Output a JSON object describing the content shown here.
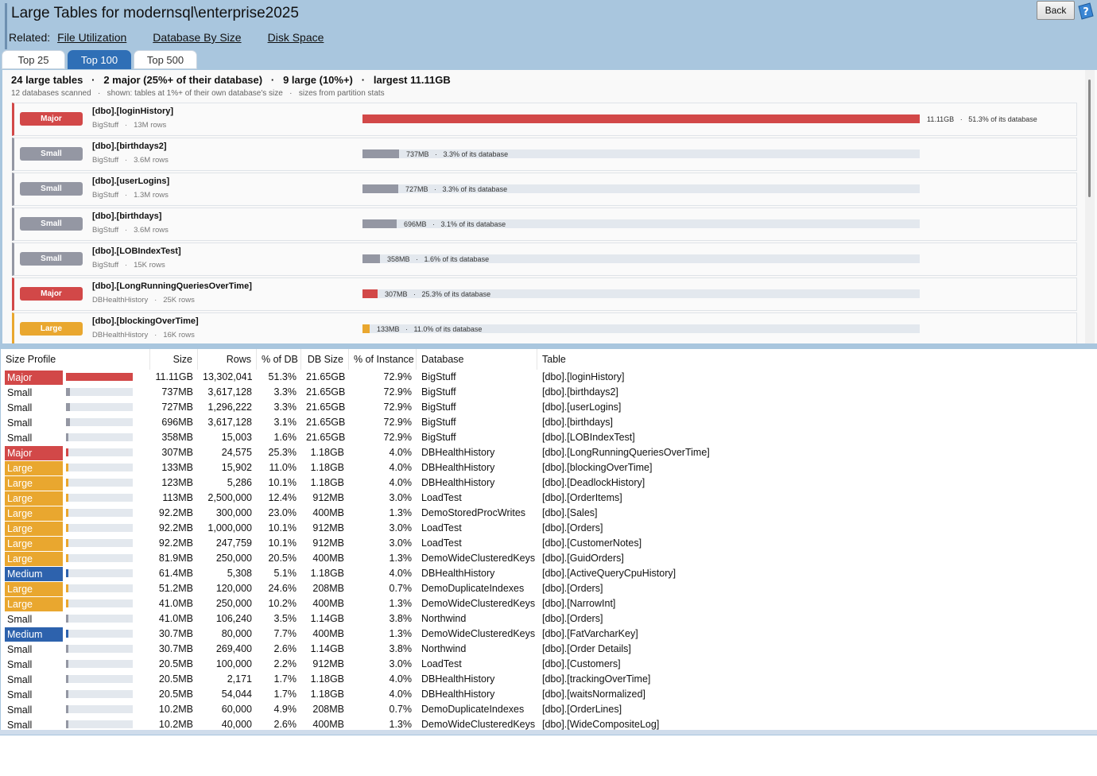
{
  "header": {
    "title": "Large Tables for modernsql\\enterprise2025",
    "back_label": "Back",
    "related_label": "Related:",
    "related_links": [
      "File Utilization",
      "Database By Size",
      "Disk Space"
    ],
    "tabs": [
      {
        "label": "Top 25",
        "active": false
      },
      {
        "label": "Top 100",
        "active": true
      },
      {
        "label": "Top 500",
        "active": false
      }
    ]
  },
  "colors": {
    "Major": "#d24848",
    "Large": "#e9a72f",
    "Medium": "#2d62ad",
    "Small": "#9497a3",
    "accent": "#2f6fb6"
  },
  "summary": {
    "line": "24 large tables   ·   2 major (25%+ of their database)   ·   9 large (10%+)   ·   largest 11.11GB",
    "sub": "12 databases scanned   ·   shown: tables at 1%+ of their own database's size   ·   sizes from partition stats"
  },
  "cards": [
    {
      "profile": "Major",
      "name": "[dbo].[loginHistory]",
      "meta": "BigStuff   ·   13M rows",
      "label": "11.11GB   ·   51.3% of its database",
      "fraction": 1.0
    },
    {
      "profile": "Small",
      "name": "[dbo].[birthdays2]",
      "meta": "BigStuff   ·   3.6M rows",
      "label": "737MB   ·   3.3% of its database",
      "fraction": 0.065
    },
    {
      "profile": "Small",
      "name": "[dbo].[userLogins]",
      "meta": "BigStuff   ·   1.3M rows",
      "label": "727MB   ·   3.3% of its database",
      "fraction": 0.064
    },
    {
      "profile": "Small",
      "name": "[dbo].[birthdays]",
      "meta": "BigStuff   ·   3.6M rows",
      "label": "696MB   ·   3.1% of its database",
      "fraction": 0.061
    },
    {
      "profile": "Small",
      "name": "[dbo].[LOBIndexTest]",
      "meta": "BigStuff   ·   15K rows",
      "label": "358MB   ·   1.6% of its database",
      "fraction": 0.032
    },
    {
      "profile": "Major",
      "name": "[dbo].[LongRunningQueriesOverTime]",
      "meta": "DBHealthHistory   ·   25K rows",
      "label": "307MB   ·   25.3% of its database",
      "fraction": 0.027
    },
    {
      "profile": "Large",
      "name": "[dbo].[blockingOverTime]",
      "meta": "DBHealthHistory   ·   16K rows",
      "label": "133MB   ·   11.0% of its database",
      "fraction": 0.012
    }
  ],
  "grid": {
    "columns": [
      "Size Profile",
      "Size",
      "Rows",
      "% of DB",
      "DB Size",
      "% of Instance",
      "Database",
      "Table"
    ],
    "rows": [
      {
        "profile": "Major",
        "fraction": 1.0,
        "size": "11.11GB",
        "rows": "13,302,041",
        "pct_db": "51.3%",
        "db_size": "21.65GB",
        "pct_inst": "72.9%",
        "database": "BigStuff",
        "table": "[dbo].[loginHistory]"
      },
      {
        "profile": "Small",
        "fraction": 0.065,
        "size": "737MB",
        "rows": "3,617,128",
        "pct_db": "3.3%",
        "db_size": "21.65GB",
        "pct_inst": "72.9%",
        "database": "BigStuff",
        "table": "[dbo].[birthdays2]"
      },
      {
        "profile": "Small",
        "fraction": 0.064,
        "size": "727MB",
        "rows": "1,296,222",
        "pct_db": "3.3%",
        "db_size": "21.65GB",
        "pct_inst": "72.9%",
        "database": "BigStuff",
        "table": "[dbo].[userLogins]"
      },
      {
        "profile": "Small",
        "fraction": 0.061,
        "size": "696MB",
        "rows": "3,617,128",
        "pct_db": "3.1%",
        "db_size": "21.65GB",
        "pct_inst": "72.9%",
        "database": "BigStuff",
        "table": "[dbo].[birthdays]"
      },
      {
        "profile": "Small",
        "fraction": 0.032,
        "size": "358MB",
        "rows": "15,003",
        "pct_db": "1.6%",
        "db_size": "21.65GB",
        "pct_inst": "72.9%",
        "database": "BigStuff",
        "table": "[dbo].[LOBIndexTest]"
      },
      {
        "profile": "Major",
        "fraction": 0.027,
        "size": "307MB",
        "rows": "24,575",
        "pct_db": "25.3%",
        "db_size": "1.18GB",
        "pct_inst": "4.0%",
        "database": "DBHealthHistory",
        "table": "[dbo].[LongRunningQueriesOverTime]"
      },
      {
        "profile": "Large",
        "fraction": 0.012,
        "size": "133MB",
        "rows": "15,902",
        "pct_db": "11.0%",
        "db_size": "1.18GB",
        "pct_inst": "4.0%",
        "database": "DBHealthHistory",
        "table": "[dbo].[blockingOverTime]"
      },
      {
        "profile": "Large",
        "fraction": 0.011,
        "size": "123MB",
        "rows": "5,286",
        "pct_db": "10.1%",
        "db_size": "1.18GB",
        "pct_inst": "4.0%",
        "database": "DBHealthHistory",
        "table": "[dbo].[DeadlockHistory]"
      },
      {
        "profile": "Large",
        "fraction": 0.01,
        "size": "113MB",
        "rows": "2,500,000",
        "pct_db": "12.4%",
        "db_size": "912MB",
        "pct_inst": "3.0%",
        "database": "LoadTest",
        "table": "[dbo].[OrderItems]"
      },
      {
        "profile": "Large",
        "fraction": 0.008,
        "size": "92.2MB",
        "rows": "300,000",
        "pct_db": "23.0%",
        "db_size": "400MB",
        "pct_inst": "1.3%",
        "database": "DemoStoredProcWrites",
        "table": "[dbo].[Sales]"
      },
      {
        "profile": "Large",
        "fraction": 0.008,
        "size": "92.2MB",
        "rows": "1,000,000",
        "pct_db": "10.1%",
        "db_size": "912MB",
        "pct_inst": "3.0%",
        "database": "LoadTest",
        "table": "[dbo].[Orders]"
      },
      {
        "profile": "Large",
        "fraction": 0.008,
        "size": "92.2MB",
        "rows": "247,759",
        "pct_db": "10.1%",
        "db_size": "912MB",
        "pct_inst": "3.0%",
        "database": "LoadTest",
        "table": "[dbo].[CustomerNotes]"
      },
      {
        "profile": "Large",
        "fraction": 0.007,
        "size": "81.9MB",
        "rows": "250,000",
        "pct_db": "20.5%",
        "db_size": "400MB",
        "pct_inst": "1.3%",
        "database": "DemoWideClusteredKeys",
        "table": "[dbo].[GuidOrders]"
      },
      {
        "profile": "Medium",
        "fraction": 0.005,
        "size": "61.4MB",
        "rows": "5,308",
        "pct_db": "5.1%",
        "db_size": "1.18GB",
        "pct_inst": "4.0%",
        "database": "DBHealthHistory",
        "table": "[dbo].[ActiveQueryCpuHistory]"
      },
      {
        "profile": "Large",
        "fraction": 0.005,
        "size": "51.2MB",
        "rows": "120,000",
        "pct_db": "24.6%",
        "db_size": "208MB",
        "pct_inst": "0.7%",
        "database": "DemoDuplicateIndexes",
        "table": "[dbo].[Orders]"
      },
      {
        "profile": "Large",
        "fraction": 0.004,
        "size": "41.0MB",
        "rows": "250,000",
        "pct_db": "10.2%",
        "db_size": "400MB",
        "pct_inst": "1.3%",
        "database": "DemoWideClusteredKeys",
        "table": "[dbo].[NarrowInt]"
      },
      {
        "profile": "Small",
        "fraction": 0.004,
        "size": "41.0MB",
        "rows": "106,240",
        "pct_db": "3.5%",
        "db_size": "1.14GB",
        "pct_inst": "3.8%",
        "database": "Northwind",
        "table": "[dbo].[Orders]"
      },
      {
        "profile": "Medium",
        "fraction": 0.003,
        "size": "30.7MB",
        "rows": "80,000",
        "pct_db": "7.7%",
        "db_size": "400MB",
        "pct_inst": "1.3%",
        "database": "DemoWideClusteredKeys",
        "table": "[dbo].[FatVarcharKey]"
      },
      {
        "profile": "Small",
        "fraction": 0.003,
        "size": "30.7MB",
        "rows": "269,400",
        "pct_db": "2.6%",
        "db_size": "1.14GB",
        "pct_inst": "3.8%",
        "database": "Northwind",
        "table": "[dbo].[Order Details]"
      },
      {
        "profile": "Small",
        "fraction": 0.002,
        "size": "20.5MB",
        "rows": "100,000",
        "pct_db": "2.2%",
        "db_size": "912MB",
        "pct_inst": "3.0%",
        "database": "LoadTest",
        "table": "[dbo].[Customers]"
      },
      {
        "profile": "Small",
        "fraction": 0.002,
        "size": "20.5MB",
        "rows": "2,171",
        "pct_db": "1.7%",
        "db_size": "1.18GB",
        "pct_inst": "4.0%",
        "database": "DBHealthHistory",
        "table": "[dbo].[trackingOverTime]"
      },
      {
        "profile": "Small",
        "fraction": 0.002,
        "size": "20.5MB",
        "rows": "54,044",
        "pct_db": "1.7%",
        "db_size": "1.18GB",
        "pct_inst": "4.0%",
        "database": "DBHealthHistory",
        "table": "[dbo].[waitsNormalized]"
      },
      {
        "profile": "Small",
        "fraction": 0.001,
        "size": "10.2MB",
        "rows": "60,000",
        "pct_db": "4.9%",
        "db_size": "208MB",
        "pct_inst": "0.7%",
        "database": "DemoDuplicateIndexes",
        "table": "[dbo].[OrderLines]"
      },
      {
        "profile": "Small",
        "fraction": 0.001,
        "size": "10.2MB",
        "rows": "40,000",
        "pct_db": "2.6%",
        "db_size": "400MB",
        "pct_inst": "1.3%",
        "database": "DemoWideClusteredKeys",
        "table": "[dbo].[WideCompositeLog]"
      }
    ]
  }
}
